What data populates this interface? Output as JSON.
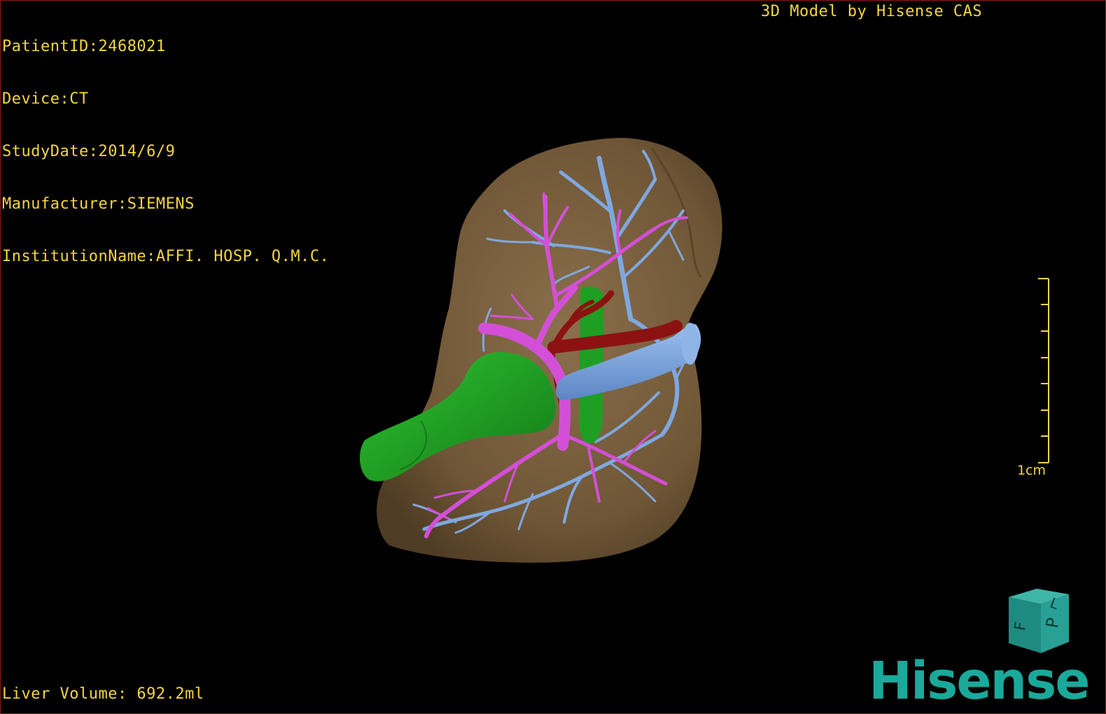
{
  "patient_info": [
    {
      "label": "PatientID:",
      "value": "2468021"
    },
    {
      "label": "Device:",
      "value": "CT"
    },
    {
      "label": "StudyDate:",
      "value": "2014/6/9"
    },
    {
      "label": "Manufacturer:",
      "value": "SIEMENS"
    },
    {
      "label": "InstitutionName:",
      "value": "AFFI. HOSP. Q.M.C."
    }
  ],
  "model_credit": "3D Model by Hisense CAS",
  "liver_volume": "Liver Volume: 692.2ml",
  "scale_bar": {
    "label": "1cm",
    "ticks": 8
  },
  "orientation_cube": {
    "faces": [
      "P",
      "F",
      "L"
    ]
  },
  "brand": "Hisense",
  "colors": {
    "overlay_text": "#f4d640",
    "liver": "#7a6140",
    "hepatic_vein": "#7fa8e0",
    "portal_vein": "#d44fd8",
    "hepatic_artery": "#8c1212",
    "gallbladder": "#1f9e24",
    "brand": "#1aa99a",
    "viewport_border": "#8a1a1a"
  }
}
